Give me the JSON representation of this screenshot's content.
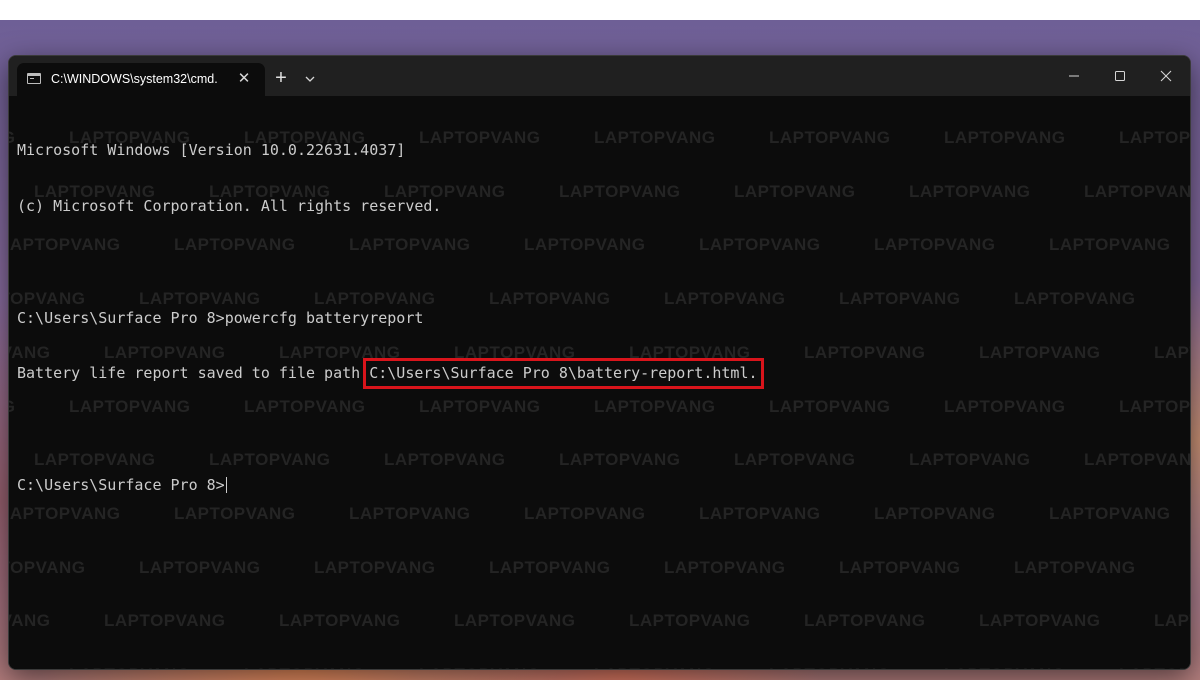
{
  "window": {
    "tab_title": "C:\\WINDOWS\\system32\\cmd.",
    "tab_close": "✕",
    "new_tab": "+"
  },
  "console": {
    "line_1": "Microsoft Windows [Version 10.0.22631.4037]",
    "line_2": "(c) Microsoft Corporation. All rights reserved.",
    "prompt_1": "C:\\Users\\Surface Pro 8>",
    "command": "powercfg batteryreport",
    "result_prefix": "Battery life report saved to file path ",
    "result_path": "C:\\Users\\Surface Pro 8\\battery-report.html.",
    "prompt_2": "C:\\Users\\Surface Pro 8>"
  },
  "watermark": {
    "text": "LAPTOPVANG"
  },
  "colors": {
    "highlight_box": "#d9141b",
    "console_background": "#0c0c0c",
    "console_text": "#cccccc"
  },
  "icons": {
    "tab_icon": "terminal-icon",
    "close": "close-icon",
    "new_tab": "plus-icon",
    "dropdown": "chevron-down-icon",
    "minimize": "minimize-icon",
    "maximize": "maximize-icon",
    "window_close": "close-icon"
  }
}
